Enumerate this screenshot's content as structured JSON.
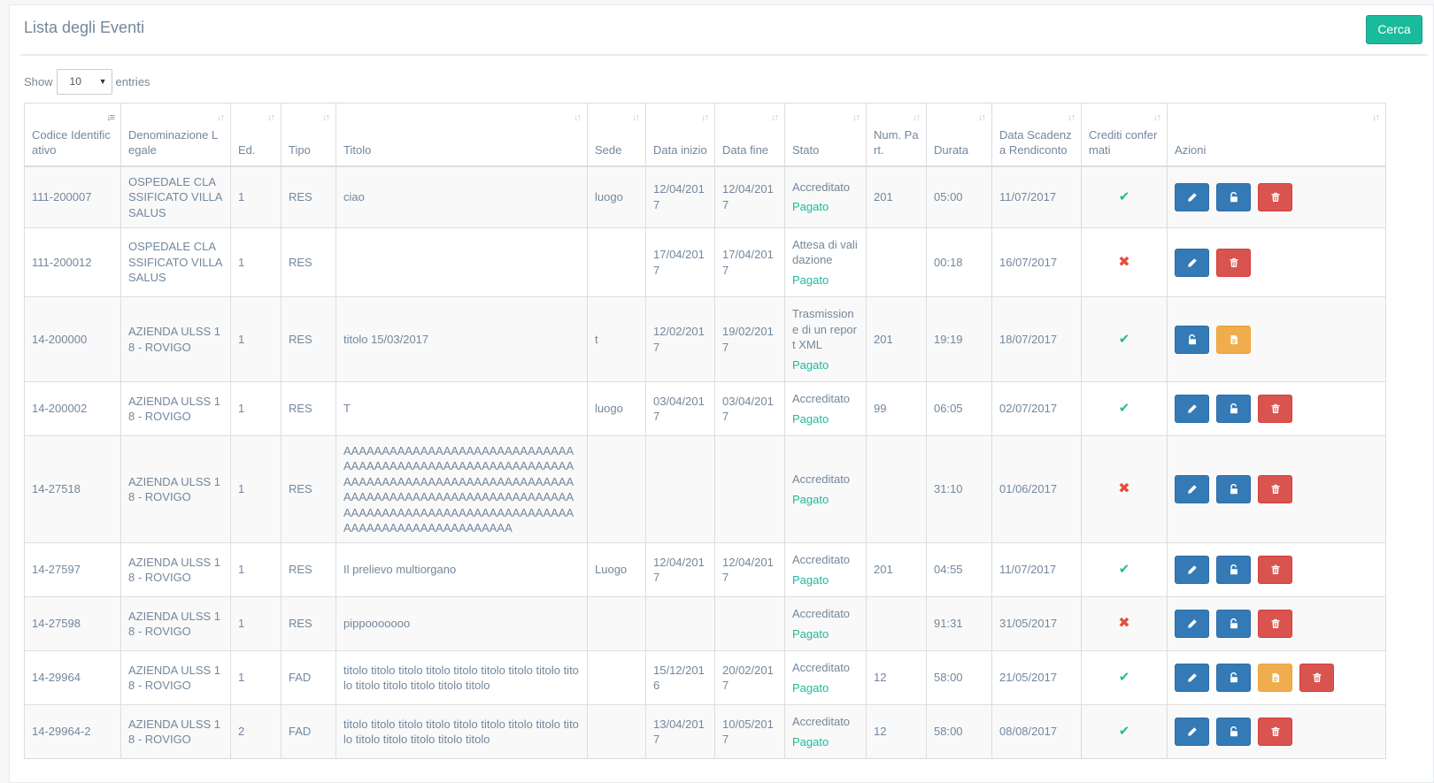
{
  "header": {
    "title": "Lista degli Eventi",
    "search_button": "Cerca"
  },
  "length": {
    "show_label": "Show",
    "selected": "10",
    "entries_label": "entries"
  },
  "columns": [
    "Codice Identificativo",
    "Denominazione Legale",
    "Ed.",
    "Tipo",
    "Titolo",
    "Sede",
    "Data inizio",
    "Data fine",
    "Stato",
    "Num. Part.",
    "Durata",
    "Data Scadenza Rendiconto",
    "Crediti confermati",
    "Azioni"
  ],
  "rows": [
    {
      "codice": "111-200007",
      "denominazione": "OSPEDALE CLASSIFICATO VILLA SALUS",
      "ed": "1",
      "tipo": "RES",
      "titolo": "ciao",
      "sede": "luogo",
      "data_inizio": "12/04/2017",
      "data_fine": "12/04/2017",
      "stato": "Accreditato",
      "pagamento": "Pagato",
      "num_part": "201",
      "durata": "05:00",
      "data_scadenza": "11/07/2017",
      "crediti_confermati": true,
      "actions": [
        "edit",
        "unlock",
        "delete"
      ]
    },
    {
      "codice": "111-200012",
      "denominazione": "OSPEDALE CLASSIFICATO VILLA SALUS",
      "ed": "1",
      "tipo": "RES",
      "titolo": "",
      "sede": "",
      "data_inizio": "17/04/2017",
      "data_fine": "17/04/2017",
      "stato": "Attesa di validazione",
      "pagamento": "Pagato",
      "num_part": "",
      "durata": "00:18",
      "data_scadenza": "16/07/2017",
      "crediti_confermati": false,
      "actions": [
        "edit",
        "delete"
      ]
    },
    {
      "codice": "14-200000",
      "denominazione": "AZIENDA ULSS 18 - ROVIGO",
      "ed": "1",
      "tipo": "RES",
      "titolo": "titolo 15/03/2017",
      "sede": "t",
      "data_inizio": "12/02/2017",
      "data_fine": "19/02/2017",
      "stato": "Trasmissione di un report XML",
      "pagamento": "Pagato",
      "num_part": "201",
      "durata": "19:19",
      "data_scadenza": "18/07/2017",
      "crediti_confermati": true,
      "actions": [
        "unlock",
        "report"
      ]
    },
    {
      "codice": "14-200002",
      "denominazione": "AZIENDA ULSS 18 - ROVIGO",
      "ed": "1",
      "tipo": "RES",
      "titolo": "T",
      "sede": "luogo",
      "data_inizio": "03/04/2017",
      "data_fine": "03/04/2017",
      "stato": "Accreditato",
      "pagamento": "Pagato",
      "num_part": "99",
      "durata": "06:05",
      "data_scadenza": "02/07/2017",
      "crediti_confermati": true,
      "actions": [
        "edit",
        "unlock",
        "delete"
      ]
    },
    {
      "codice": "14-27518",
      "denominazione": "AZIENDA ULSS 18 - ROVIGO",
      "ed": "1",
      "tipo": "RES",
      "titolo": "AAAAAAAAAAAAAAAAAAAAAAAAAAAAAAAAAAAAAAAAAAAAAAAAAAAAAAAAAAAAAAAAAAAAAAAAAAAAAAAAAAAAAAAAAAAAAAAAAAAAAAAAAAAAAAAAAAAAAAAAAAAAAAAAAAAAAAAAAAAAAAAAAAAAAAAAAAAAAAAAAAAAAAAAAAAA",
      "sede": "",
      "data_inizio": "",
      "data_fine": "",
      "stato": "Accreditato",
      "pagamento": "Pagato",
      "num_part": "",
      "durata": "31:10",
      "data_scadenza": "01/06/2017",
      "crediti_confermati": false,
      "actions": [
        "edit",
        "unlock",
        "delete"
      ]
    },
    {
      "codice": "14-27597",
      "denominazione": "AZIENDA ULSS 18 - ROVIGO",
      "ed": "1",
      "tipo": "RES",
      "titolo": "Il prelievo multiorgano",
      "sede": "Luogo",
      "data_inizio": "12/04/2017",
      "data_fine": "12/04/2017",
      "stato": "Accreditato",
      "pagamento": "Pagato",
      "num_part": "201",
      "durata": "04:55",
      "data_scadenza": "11/07/2017",
      "crediti_confermati": true,
      "actions": [
        "edit",
        "unlock",
        "delete"
      ]
    },
    {
      "codice": "14-27598",
      "denominazione": "AZIENDA ULSS 18 - ROVIGO",
      "ed": "1",
      "tipo": "RES",
      "titolo": "pippooooooo",
      "sede": "",
      "data_inizio": "",
      "data_fine": "",
      "stato": "Accreditato",
      "pagamento": "Pagato",
      "num_part": "",
      "durata": "91:31",
      "data_scadenza": "31/05/2017",
      "crediti_confermati": false,
      "actions": [
        "edit",
        "unlock",
        "delete"
      ]
    },
    {
      "codice": "14-29964",
      "denominazione": "AZIENDA ULSS 18 - ROVIGO",
      "ed": "1",
      "tipo": "FAD",
      "titolo": "titolo titolo titolo titolo titolo titolo titolo titolo titolo titolo titolo titolo titolo titolo",
      "sede": "",
      "data_inizio": "15/12/2016",
      "data_fine": "20/02/2017",
      "stato": "Accreditato",
      "pagamento": "Pagato",
      "num_part": "12",
      "durata": "58:00",
      "data_scadenza": "21/05/2017",
      "crediti_confermati": true,
      "actions": [
        "edit",
        "unlock",
        "report",
        "delete"
      ]
    },
    {
      "codice": "14-29964-2",
      "denominazione": "AZIENDA ULSS 18 - ROVIGO",
      "ed": "2",
      "tipo": "FAD",
      "titolo": "titolo titolo titolo titolo titolo titolo titolo titolo titolo titolo titolo titolo titolo titolo",
      "sede": "",
      "data_inizio": "13/04/2017",
      "data_fine": "10/05/2017",
      "stato": "Accreditato",
      "pagamento": "Pagato",
      "num_part": "12",
      "durata": "58:00",
      "data_scadenza": "08/08/2017",
      "crediti_confermati": true,
      "actions": [
        "edit",
        "unlock",
        "delete"
      ]
    }
  ],
  "icons": {
    "check": "check-icon",
    "cross": "cross-icon",
    "edit": "pencil-icon",
    "unlock": "unlock-icon",
    "report": "file-icon",
    "delete": "trash-icon"
  },
  "colors": {
    "success": "#1abb9c",
    "primary": "#337ab7",
    "danger": "#d9534f",
    "warning": "#f0ad4e",
    "error_mark": "#e74c3c"
  }
}
